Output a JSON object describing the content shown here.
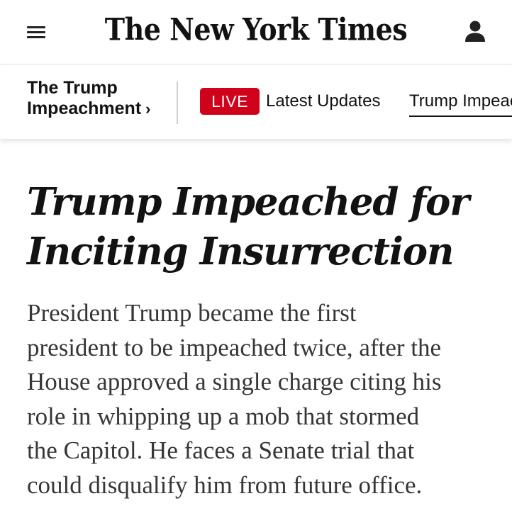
{
  "masthead": {
    "logo_text": "The New York Times",
    "menu_icon": "hamburger-menu-icon",
    "account_icon": "user-account-icon"
  },
  "section_bar": {
    "title_lines": [
      "The Trump",
      "Impeachment"
    ],
    "chevron": "›",
    "live_badge": "LIVE",
    "tabs": [
      {
        "label": "Latest Updates"
      },
      {
        "label": "Trump Impeac"
      }
    ],
    "live_color": "#d0021b"
  },
  "article": {
    "headline_lines": [
      "Trump Impeached for",
      "Inciting Insurrection"
    ],
    "summary_lines": [
      "President Trump became the first",
      "president to be impeached twice, after the",
      "House approved a single charge citing his",
      "role in whipping up a mob that stormed",
      "the Capitol. He faces a Senate trial that",
      "could disqualify him from future office."
    ]
  }
}
